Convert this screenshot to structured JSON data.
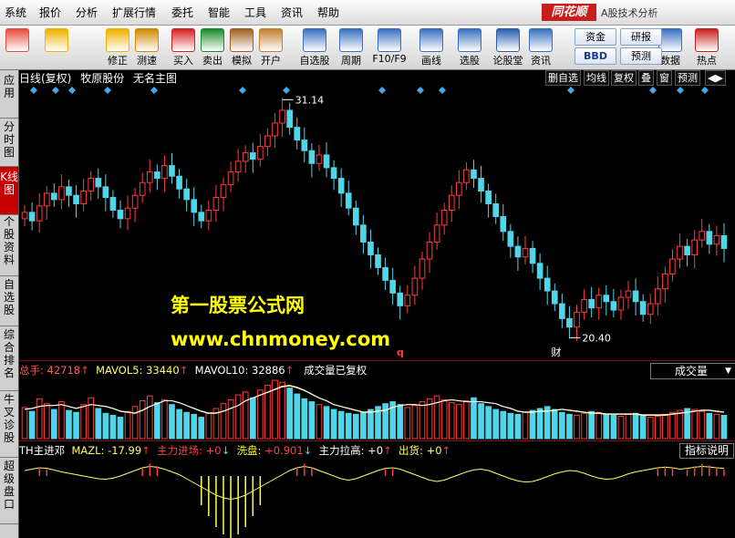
{
  "menubar": {
    "items": [
      "系统",
      "报价",
      "分析",
      "扩展行情",
      "委托",
      "智能",
      "工具",
      "资讯",
      "帮助"
    ],
    "brand": "同花顺",
    "subtitle": "A股技术分析"
  },
  "toolbar": {
    "buttons": [
      {
        "label": "",
        "icon": "grid-color-icon",
        "color": "#e74c3c"
      },
      {
        "label": "",
        "icon": "back-arrow-icon",
        "color": "#f0b000"
      },
      {
        "label": "修正",
        "icon": "refresh-icon",
        "color": "#f0b000"
      },
      {
        "label": "测速",
        "icon": "clock-icon",
        "color": "#d08a00"
      },
      {
        "label": "买入",
        "icon": "buy-icon",
        "color": "#d42020"
      },
      {
        "label": "卖出",
        "icon": "sell-icon",
        "color": "#1a8a2a"
      },
      {
        "label": "模拟",
        "icon": "gavel-icon",
        "color": "#a06020"
      },
      {
        "label": "开户",
        "icon": "lock-icon",
        "color": "#c08030"
      },
      {
        "label": "自选股",
        "icon": "star-folder-icon",
        "color": "#3a6fc0"
      },
      {
        "label": "周期",
        "icon": "cycle-icon",
        "color": "#3a6fc0"
      },
      {
        "label": "F10/F9",
        "icon": "f10-icon",
        "color": "#3a6fc0"
      },
      {
        "label": "画线",
        "icon": "pen-icon",
        "color": "#3a6fc0"
      },
      {
        "label": "选股",
        "icon": "monitor-icon",
        "color": "#3a6fc0"
      },
      {
        "label": "论股堂",
        "icon": "chat-icon",
        "color": "#2a5fb0"
      },
      {
        "label": "资讯",
        "icon": "news-icon",
        "color": "#3a6fc0"
      },
      {
        "label": "数据",
        "icon": "pe-icon",
        "color": "#3a6fc0"
      },
      {
        "label": "热点",
        "icon": "hot-icon",
        "color": "#c82020"
      }
    ],
    "text_buttons": [
      "资金",
      "研报",
      "BBD",
      "预测"
    ]
  },
  "sidetabs": [
    "应用",
    "分时图",
    "K线图",
    "个股资料",
    "自选股",
    "综合排名",
    "牛叉诊股",
    "超级盘口"
  ],
  "kline": {
    "period": "日线(复权)",
    "stock": "牧原股份",
    "main_name": "无名主图",
    "controls": [
      "删自选",
      "均线",
      "复权",
      "叠",
      "窗",
      "预测"
    ],
    "high_label": "31.14",
    "low_label": "20.40",
    "marker_q": "q",
    "marker_cai": "财"
  },
  "volume": {
    "total_label": "总手:",
    "total_value": "42718",
    "mavol5_label": "MAVOL5:",
    "mavol5_value": "33440",
    "mavol10_label": "MAVOL10:",
    "mavol10_value": "32886",
    "note": "成交量已复权",
    "selector": "成交量"
  },
  "indicator": {
    "name": "TH主进邓",
    "mazl_label": "MAZL:",
    "mazl_value": "-17.99",
    "zljc_label": "主力进场:",
    "zljc_value": "+0",
    "xp_label": "洗盘:",
    "xp_value": "+0.901",
    "zllg_label": "主力拉高:",
    "zllg_value": "+0",
    "ch_label": "出货:",
    "ch_value": "+0",
    "desc_button": "指标说明"
  },
  "watermark": {
    "line1": "第一股票公式网",
    "line2": "www.chnmoney.com"
  },
  "colors": {
    "up": "#ff3b3b",
    "down": "#4fd6e8",
    "yellow": "#ffff00",
    "white": "#ffffff",
    "diamond": "#49a6e8",
    "active_tab": "#c60000"
  },
  "chart_data": {
    "type": "candlestick",
    "high_marker": 31.14,
    "low_marker": 20.4,
    "close": [
      26.2,
      25.8,
      26.5,
      27.1,
      26.8,
      27.4,
      27.0,
      26.6,
      27.2,
      27.8,
      27.4,
      26.9,
      26.3,
      25.9,
      26.4,
      27.0,
      27.6,
      28.1,
      27.8,
      28.4,
      27.9,
      27.3,
      26.8,
      26.2,
      25.8,
      26.3,
      26.9,
      27.5,
      28.1,
      28.6,
      29.0,
      28.7,
      29.3,
      29.8,
      30.4,
      31.0,
      30.2,
      29.6,
      29.1,
      28.5,
      28.9,
      28.3,
      27.8,
      27.1,
      26.4,
      25.6,
      24.8,
      24.2,
      23.6,
      23.0,
      22.4,
      21.8,
      22.3,
      23.1,
      24.0,
      24.8,
      25.6,
      26.3,
      27.0,
      27.6,
      28.2,
      27.8,
      27.2,
      26.6,
      26.0,
      25.3,
      24.6,
      24.1,
      24.5,
      23.8,
      23.1,
      22.5,
      21.9,
      21.2,
      20.8,
      21.5,
      22.1,
      21.7,
      22.3,
      22.0,
      21.6,
      22.2,
      22.5,
      22.0,
      21.4,
      21.9,
      22.6,
      23.3,
      24.0,
      24.6,
      24.2,
      24.9,
      25.3,
      24.7,
      25.1,
      24.5
    ],
    "volume": [
      32,
      28,
      41,
      36,
      30,
      38,
      29,
      27,
      35,
      42,
      31,
      26,
      24,
      22,
      28,
      33,
      39,
      44,
      37,
      40,
      35,
      30,
      27,
      25,
      22,
      26,
      31,
      36,
      40,
      45,
      48,
      42,
      50,
      55,
      60,
      58,
      52,
      46,
      41,
      38,
      35,
      33,
      30,
      28,
      26,
      25,
      27,
      30,
      33,
      36,
      38,
      35,
      32,
      34,
      38,
      41,
      44,
      40,
      37,
      35,
      39,
      42,
      36,
      33,
      30,
      28,
      26,
      25,
      27,
      29,
      31,
      33,
      30,
      27,
      25,
      24,
      26,
      28,
      27,
      25,
      24,
      23,
      25,
      26,
      24,
      22,
      23,
      25,
      27,
      29,
      31,
      30,
      28,
      26,
      25,
      24
    ],
    "mavol5": [
      30,
      31,
      33,
      34,
      34,
      35,
      33,
      31,
      33,
      35,
      34,
      33,
      31,
      28,
      27,
      26,
      29,
      33,
      36,
      39,
      39,
      37,
      34,
      31,
      28,
      26,
      26,
      28,
      31,
      34,
      39,
      42,
      45,
      48,
      51,
      54,
      55,
      53,
      50,
      46,
      42,
      39,
      35,
      33,
      31,
      29,
      27,
      27,
      28,
      29,
      32,
      34,
      35,
      35,
      34,
      35,
      37,
      39,
      40,
      39,
      38,
      38,
      38,
      37,
      36,
      33,
      31,
      28,
      27,
      27,
      28,
      28,
      29,
      30,
      29,
      28,
      27,
      26,
      26,
      25,
      25,
      25,
      25,
      25,
      24,
      24,
      24,
      24,
      25,
      26,
      27,
      28,
      29,
      29,
      28,
      27
    ],
    "indicator_osc": [
      0.2,
      0.25,
      0.3,
      0.28,
      0.22,
      0.15,
      0.1,
      0.05,
      0.0,
      -0.05,
      -0.1,
      -0.12,
      -0.08,
      0.0,
      0.1,
      0.2,
      0.3,
      0.35,
      0.32,
      0.25,
      0.15,
      0.05,
      -0.1,
      -0.25,
      -0.4,
      -0.55,
      -0.7,
      -0.8,
      -0.85,
      -0.8,
      -0.7,
      -0.55,
      -0.4,
      -0.25,
      -0.1,
      0.05,
      0.2,
      0.3,
      0.35,
      0.3,
      0.2,
      0.1,
      0.0,
      -0.1,
      -0.15,
      -0.1,
      0.0,
      0.1,
      0.2,
      0.28,
      0.3,
      0.25,
      0.15,
      0.05,
      -0.05,
      -0.15,
      -0.2,
      -0.15,
      -0.05,
      0.05,
      0.15,
      0.22,
      0.25,
      0.2,
      0.1,
      0.0,
      -0.1,
      -0.18,
      -0.22,
      -0.2,
      -0.12,
      -0.02,
      0.08,
      0.15,
      0.2,
      0.18,
      0.1,
      0.0,
      -0.08,
      -0.12,
      -0.1,
      -0.02,
      0.08,
      0.15,
      0.2,
      0.25,
      0.3,
      0.32,
      0.3,
      0.25,
      0.28,
      0.32,
      0.35,
      0.33,
      0.3,
      0.28
    ]
  }
}
